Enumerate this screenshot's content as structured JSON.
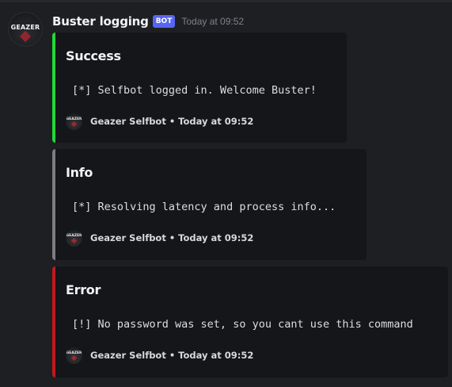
{
  "message": {
    "author": "Buster logging",
    "bot_tag": "BOT",
    "timestamp": "Today at 09:52",
    "avatar_text": "GEAZER"
  },
  "embeds": [
    {
      "title": "Success",
      "description": "[*] Selfbot logged in. Welcome Buster!",
      "footer_icon_text": "GEAZER",
      "footer": "Geazer Selfbot • Today at 09:52",
      "color": "#22d83a"
    },
    {
      "title": "Info",
      "description": "[*] Resolving latency and process info...",
      "footer_icon_text": "GEAZER",
      "footer": "Geazer Selfbot • Today at 09:52",
      "color": "#7b7d82"
    },
    {
      "title": "Error",
      "description": "[!] No password was set, so you cant use this command",
      "footer_icon_text": "GEAZER",
      "footer": "Geazer Selfbot • Today at 09:52",
      "color": "#c4171f"
    }
  ]
}
